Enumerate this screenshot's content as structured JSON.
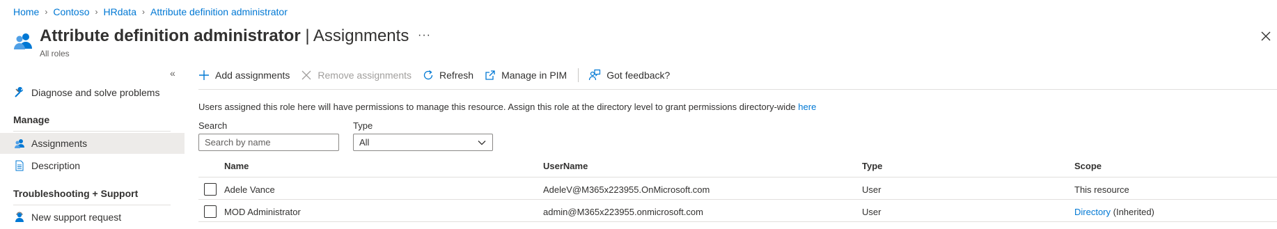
{
  "breadcrumb": {
    "items": [
      "Home",
      "Contoso",
      "HRdata",
      "Attribute definition administrator"
    ]
  },
  "header": {
    "title": "Attribute definition administrator",
    "title_suffix": "| Assignments",
    "subtitle": "All roles",
    "more_label": "···"
  },
  "sidebar": {
    "collapse_label": "«",
    "diagnose_label": "Diagnose and solve problems",
    "manage_heading": "Manage",
    "assignments_label": "Assignments",
    "description_label": "Description",
    "support_heading": "Troubleshooting + Support",
    "support_request_label": "New support request"
  },
  "toolbar": {
    "add_label": "Add assignments",
    "remove_label": "Remove assignments",
    "refresh_label": "Refresh",
    "manage_pim_label": "Manage in PIM",
    "feedback_label": "Got feedback?"
  },
  "info": {
    "text": "Users assigned this role here will have permissions to manage this resource. Assign this role at the directory level to grant permissions directory-wide",
    "link": "here"
  },
  "filters": {
    "search_label": "Search",
    "search_placeholder": "Search by name",
    "search_value": "",
    "type_label": "Type",
    "type_value": "All"
  },
  "table": {
    "columns": [
      "Name",
      "UserName",
      "Type",
      "Scope"
    ],
    "rows": [
      {
        "name": "Adele Vance",
        "username": "AdeleV@M365x223955.OnMicrosoft.com",
        "type": "User",
        "scope": "This resource",
        "scope_suffix": ""
      },
      {
        "name": "MOD Administrator",
        "username": "admin@M365x223955.onmicrosoft.com",
        "type": "User",
        "scope": "Directory",
        "scope_suffix": "(Inherited)"
      }
    ]
  },
  "colors": {
    "accent": "#0078d4",
    "text": "#323130",
    "disabled": "#a19f9d",
    "active_nav_bg": "#edebe9"
  }
}
